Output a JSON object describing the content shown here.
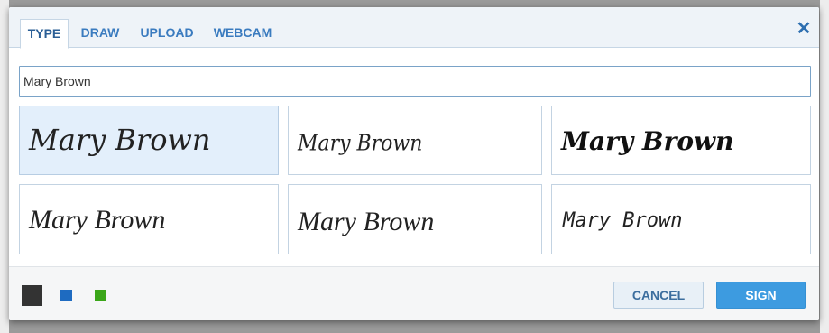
{
  "tabs": [
    {
      "label": "TYPE",
      "active": true
    },
    {
      "label": "DRAW",
      "active": false
    },
    {
      "label": "UPLOAD",
      "active": false
    },
    {
      "label": "WEBCAM",
      "active": false
    }
  ],
  "close_icon": "close-icon",
  "name_input": {
    "value": "Mary Brown"
  },
  "signature_options": [
    {
      "text": "Mary Brown",
      "selected": true
    },
    {
      "text": "Mary Brown",
      "selected": false
    },
    {
      "text": "Mary Brown",
      "selected": false
    },
    {
      "text": "Mary Brown",
      "selected": false
    },
    {
      "text": "Mary Brown",
      "selected": false
    },
    {
      "text": "Mary Brown",
      "selected": false
    }
  ],
  "ink_colors": [
    {
      "name": "black",
      "hex": "#333333",
      "selected": true
    },
    {
      "name": "blue",
      "hex": "#1e6bc1",
      "selected": false
    },
    {
      "name": "green",
      "hex": "#3aa619",
      "selected": false
    }
  ],
  "buttons": {
    "cancel": "CANCEL",
    "sign": "SIGN"
  },
  "colors": {
    "accent": "#3d9be0",
    "tab_text": "#3a7bbf",
    "selected_option": "#e3effb"
  }
}
